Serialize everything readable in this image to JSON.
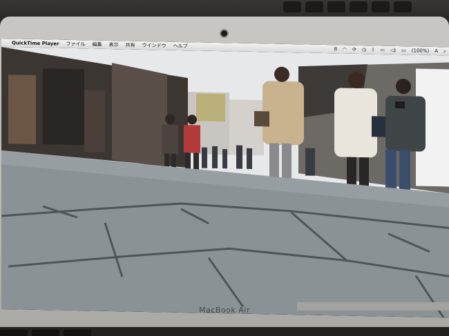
{
  "device": {
    "brand_label": "MacBook Air"
  },
  "menubar": {
    "apple_glyph": "",
    "app_name": "QuickTime Player",
    "menus": [
      "ファイル",
      "編集",
      "表示",
      "共有",
      "ウインドウ",
      "ヘルプ"
    ],
    "status": {
      "adobe_badge": "8",
      "battery_text": "(100%)",
      "input_badge": "A"
    }
  },
  "video": {
    "scene": "street"
  },
  "colors": {
    "sky": "#e6e8ea",
    "pavement": "#8a9296",
    "pavement_lines": "#4e5558",
    "shop_left": "#3c3632",
    "coat_beige": "#c9b28e",
    "coat_white": "#e9e4dc"
  }
}
